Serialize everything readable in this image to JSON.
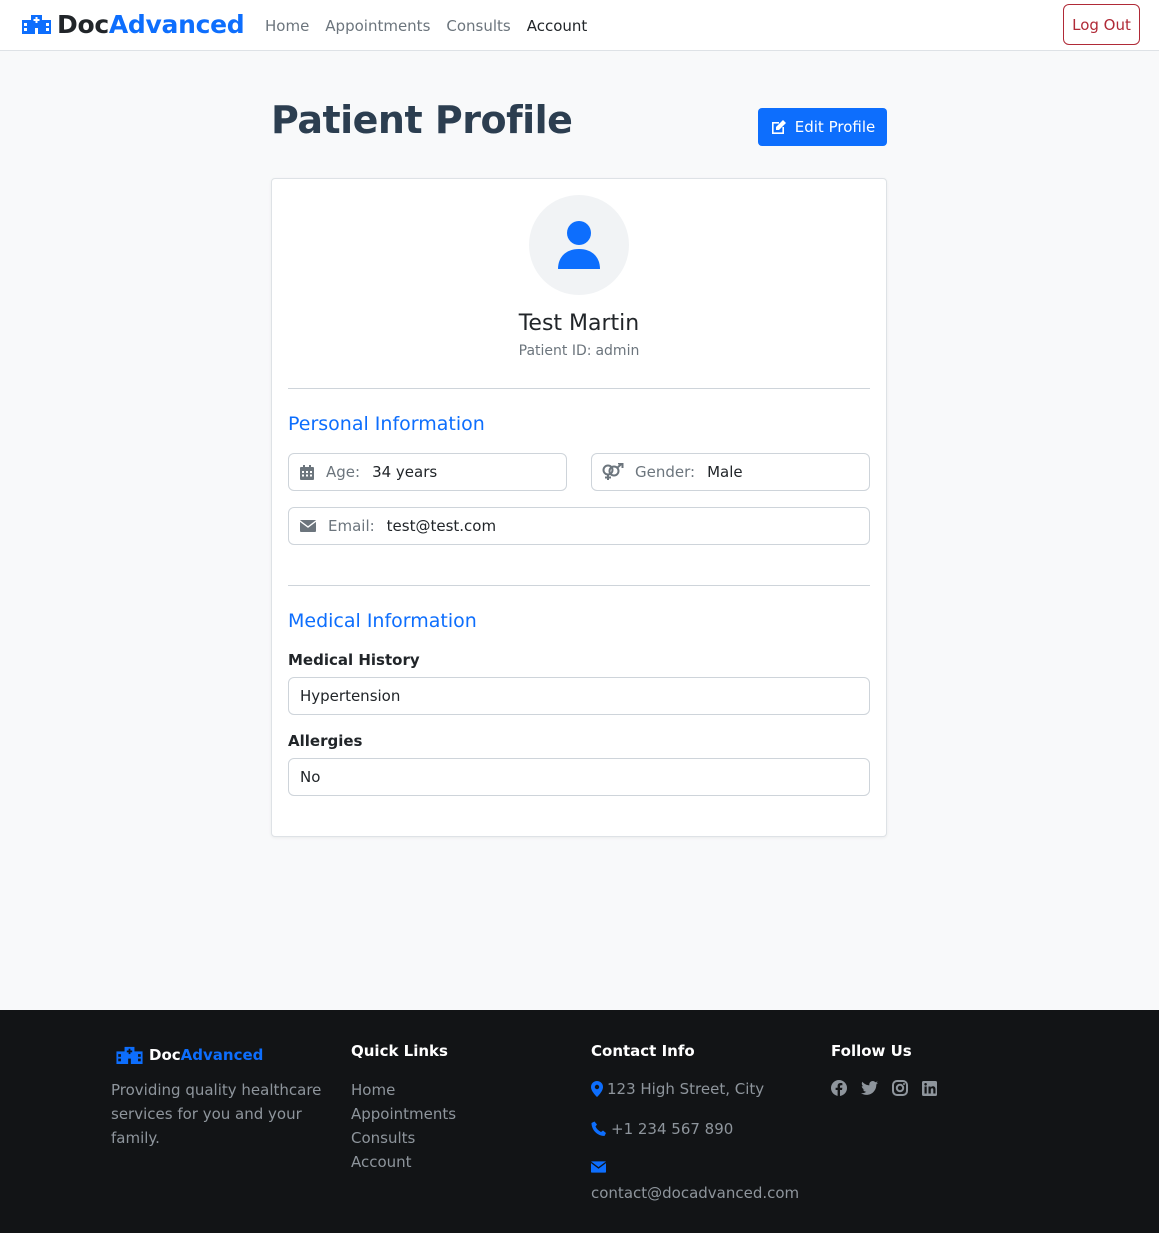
{
  "brand": {
    "part1": "Doc",
    "part2": "Advanced"
  },
  "nav": {
    "links": [
      "Home",
      "Appointments",
      "Consults",
      "Account"
    ],
    "active": "Account",
    "logout_label": "Log Out"
  },
  "page": {
    "title": "Patient Profile",
    "edit_label": "Edit Profile"
  },
  "profile": {
    "name": "Test Martin",
    "id_label": "Patient ID:",
    "id_value": "admin"
  },
  "personal": {
    "title": "Personal Information",
    "age_label": "Age:",
    "age_value": "34 years",
    "gender_label": "Gender:",
    "gender_value": "Male",
    "email_label": "Email:",
    "email_value": "test@test.com"
  },
  "medical": {
    "title": "Medical Information",
    "history_label": "Medical History",
    "history_value": "Hypertension",
    "allergies_label": "Allergies",
    "allergies_value": "No"
  },
  "footer": {
    "description": "Providing quality healthcare services for you and your family.",
    "quick_links_heading": "Quick Links",
    "quick_links": [
      "Home",
      "Appointments",
      "Consults",
      "Account"
    ],
    "contact_heading": "Contact Info",
    "address": "123 High Street, City",
    "phone": "+1 234 567 890",
    "email": "contact@docadvanced.com",
    "follow_heading": "Follow Us",
    "social_icons": [
      "facebook-icon",
      "twitter-icon",
      "instagram-icon",
      "linkedin-icon"
    ]
  },
  "colors": {
    "primary": "#0d6efd",
    "danger": "#b02a37",
    "title": "#2c3e50",
    "footer_bg": "#121416"
  }
}
